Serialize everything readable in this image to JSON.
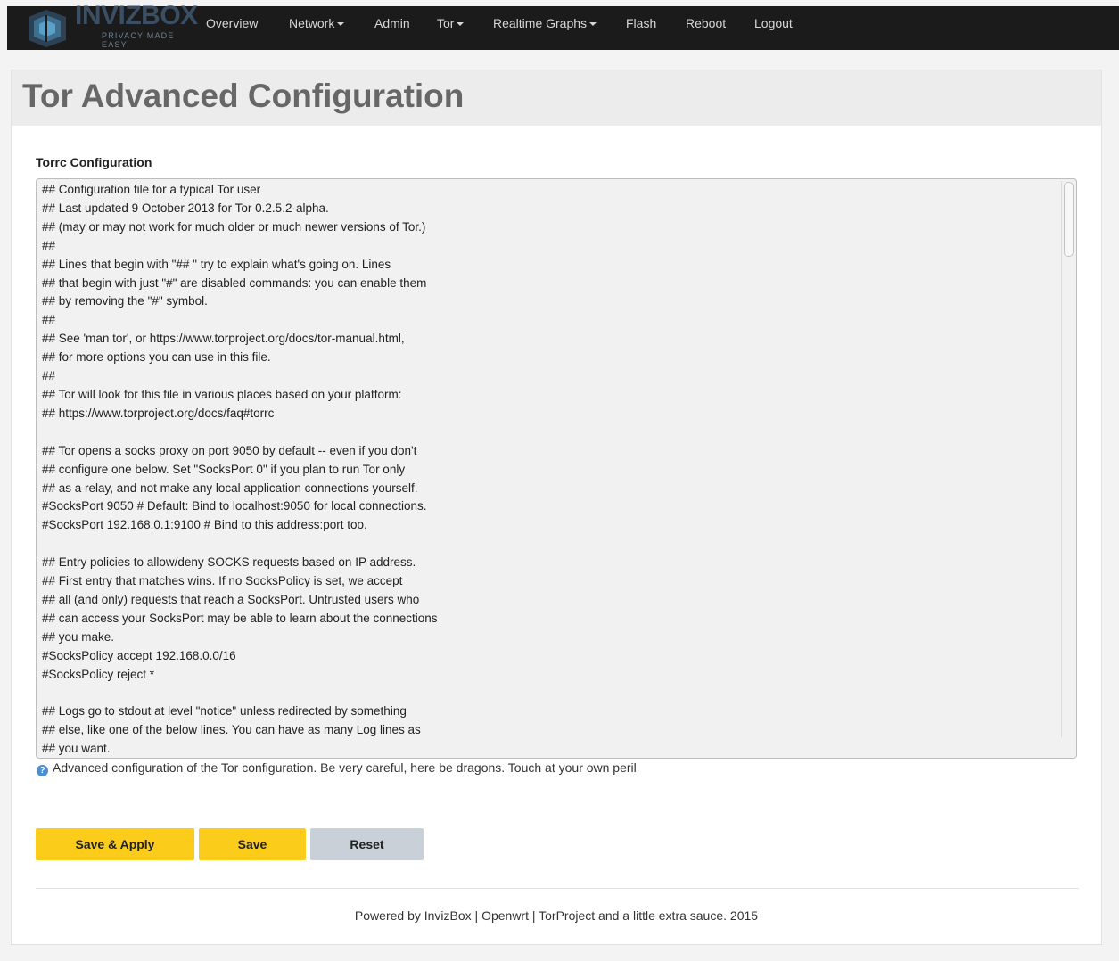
{
  "brand": {
    "name": "INVIZBOX",
    "tagline": "PRIVACY MADE EASY"
  },
  "nav": [
    {
      "label": "Overview",
      "dropdown": false
    },
    {
      "label": "Network",
      "dropdown": true
    },
    {
      "label": "Admin",
      "dropdown": false
    },
    {
      "label": "Tor",
      "dropdown": true
    },
    {
      "label": "Realtime Graphs",
      "dropdown": true
    },
    {
      "label": "Flash",
      "dropdown": false
    },
    {
      "label": "Reboot",
      "dropdown": false
    },
    {
      "label": "Logout",
      "dropdown": false
    }
  ],
  "page": {
    "title": "Tor Advanced Configuration"
  },
  "torrc": {
    "label": "Torrc Configuration",
    "lines": [
      "## Configuration file for a typical Tor user",
      "## Last updated 9 October 2013 for Tor 0.2.5.2-alpha.",
      "## (may or may not work for much older or much newer versions of Tor.)",
      "##",
      "## Lines that begin with \"## \" try to explain what's going on. Lines",
      "## that begin with just \"#\" are disabled commands: you can enable them",
      "## by removing the \"#\" symbol.",
      "##",
      "## See 'man tor', or https://www.torproject.org/docs/tor-manual.html,",
      "## for more options you can use in this file.",
      "##",
      "## Tor will look for this file in various places based on your platform:",
      "## https://www.torproject.org/docs/faq#torrc",
      "",
      "## Tor opens a socks proxy on port 9050 by default -- even if you don't",
      "## configure one below. Set \"SocksPort 0\" if you plan to run Tor only",
      "## as a relay, and not make any local application connections yourself.",
      "#SocksPort 9050 # Default: Bind to localhost:9050 for local connections.",
      "#SocksPort 192.168.0.1:9100 # Bind to this address:port too.",
      "",
      "## Entry policies to allow/deny SOCKS requests based on IP address.",
      "## First entry that matches wins. If no SocksPolicy is set, we accept",
      "## all (and only) requests that reach a SocksPort. Untrusted users who",
      "## can access your SocksPort may be able to learn about the connections",
      "## you make.",
      "#SocksPolicy accept 192.168.0.0/16",
      "#SocksPolicy reject *",
      "",
      "## Logs go to stdout at level \"notice\" unless redirected by something",
      "## else, like one of the below lines. You can have as many Log lines as",
      "## you want."
    ],
    "help": "Advanced configuration of the Tor configuration. Be very careful, here be dragons. Touch at your own peril"
  },
  "buttons": {
    "save_apply": "Save & Apply",
    "save": "Save",
    "reset": "Reset"
  },
  "footer": {
    "text": "Powered by InvizBox | Openwrt | TorProject and a little extra sauce. 2015"
  },
  "colors": {
    "navbar": "#1b1b1b",
    "primary_button": "#fccc1b",
    "reset_button": "#c9d0d8",
    "title": "#676767"
  }
}
